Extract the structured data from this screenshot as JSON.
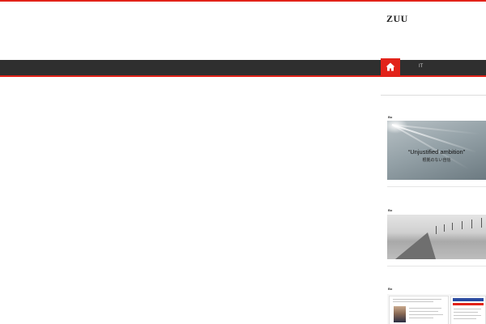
{
  "site": {
    "title": "ZUU"
  },
  "nav": {
    "home_icon": "home-icon",
    "items": [
      {
        "label": "IT"
      }
    ]
  },
  "sidebar": {
    "widgets": [
      {
        "label": "Bo",
        "image": {
          "title": "“Unjustified ambition”",
          "subtitle": "根拠のない自信"
        }
      },
      {
        "label": "Bo",
        "image": {}
      },
      {
        "label": "Bo",
        "image": {}
      }
    ]
  },
  "colors": {
    "accent": "#e2231a",
    "nav_bg": "#2f2f2f"
  }
}
